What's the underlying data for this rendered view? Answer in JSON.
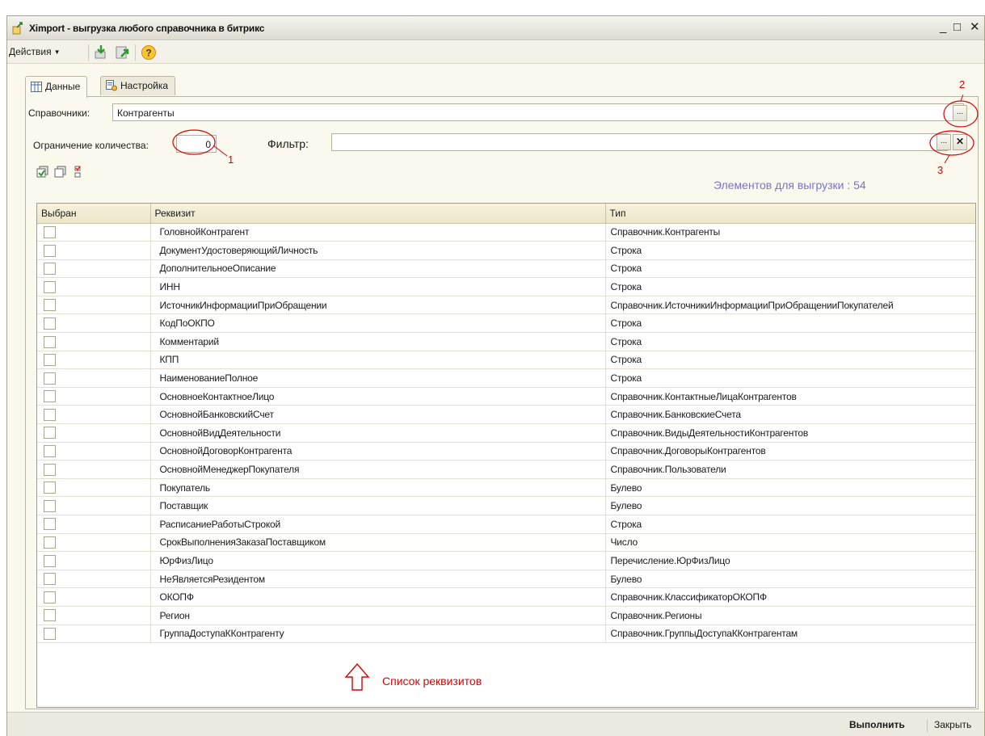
{
  "window": {
    "title": "Ximport - выгрузка любого справочника в битрикс",
    "minimize": "_",
    "maximize": "□",
    "close": "✕"
  },
  "toolbar": {
    "actions_label": "Действия",
    "help_glyph": "?"
  },
  "tabs": [
    {
      "label": "Данные"
    },
    {
      "label": "Настройка"
    }
  ],
  "form": {
    "catalogs_label": "Справочники:",
    "catalogs_value": "Контрагенты",
    "select_glyph": "...",
    "limit_label": "Ограничение количества:",
    "limit_value": "0",
    "filter_label": "Фильтр:",
    "filter_value": "",
    "clear_glyph": "✕",
    "elements_count_text": "Элементов для выгрузки : 54"
  },
  "annotations": {
    "n1": "1",
    "n2": "2",
    "n3": "3",
    "list_label": "Список реквизитов"
  },
  "table": {
    "columns": [
      "Выбран",
      "Реквизит",
      "Тип"
    ],
    "rows": [
      {
        "attr": "ГоловнойКонтрагент",
        "type": "Справочник.Контрагенты"
      },
      {
        "attr": "ДокументУдостоверяющийЛичность",
        "type": "Строка"
      },
      {
        "attr": "ДополнительноеОписание",
        "type": "Строка"
      },
      {
        "attr": "ИНН",
        "type": "Строка"
      },
      {
        "attr": "ИсточникИнформацииПриОбращении",
        "type": "Справочник.ИсточникиИнформацииПриОбращенииПокупателей"
      },
      {
        "attr": "КодПоОКПО",
        "type": "Строка"
      },
      {
        "attr": "Комментарий",
        "type": "Строка"
      },
      {
        "attr": "КПП",
        "type": "Строка"
      },
      {
        "attr": "НаименованиеПолное",
        "type": "Строка"
      },
      {
        "attr": "ОсновноеКонтактноеЛицо",
        "type": "Справочник.КонтактныеЛицаКонтрагентов"
      },
      {
        "attr": "ОсновнойБанковскийСчет",
        "type": "Справочник.БанковскиеСчета"
      },
      {
        "attr": "ОсновнойВидДеятельности",
        "type": "Справочник.ВидыДеятельностиКонтрагентов"
      },
      {
        "attr": "ОсновнойДоговорКонтрагента",
        "type": "Справочник.ДоговорыКонтрагентов"
      },
      {
        "attr": "ОсновнойМенеджерПокупателя",
        "type": "Справочник.Пользователи"
      },
      {
        "attr": "Покупатель",
        "type": "Булево"
      },
      {
        "attr": "Поставщик",
        "type": "Булево"
      },
      {
        "attr": "РасписаниеРаботыСтрокой",
        "type": "Строка"
      },
      {
        "attr": "СрокВыполненияЗаказаПоставщиком",
        "type": "Число"
      },
      {
        "attr": "ЮрФизЛицо",
        "type": "Перечисление.ЮрФизЛицо"
      },
      {
        "attr": "НеЯвляетсяРезидентом",
        "type": "Булево"
      },
      {
        "attr": "ОКОПФ",
        "type": "Справочник.КлассификаторОКОПФ"
      },
      {
        "attr": "Регион",
        "type": "Справочник.Регионы"
      },
      {
        "attr": "ГруппаДоступаККонтрагенту",
        "type": "Справочник.ГруппыДоступаККонтрагентам"
      }
    ]
  },
  "footer": {
    "run_label": "Выполнить",
    "close_label": "Закрыть"
  },
  "colors": {
    "annotation": "#e00000",
    "counter": "#7a71d8",
    "window_bg": "#fbf9ee"
  }
}
